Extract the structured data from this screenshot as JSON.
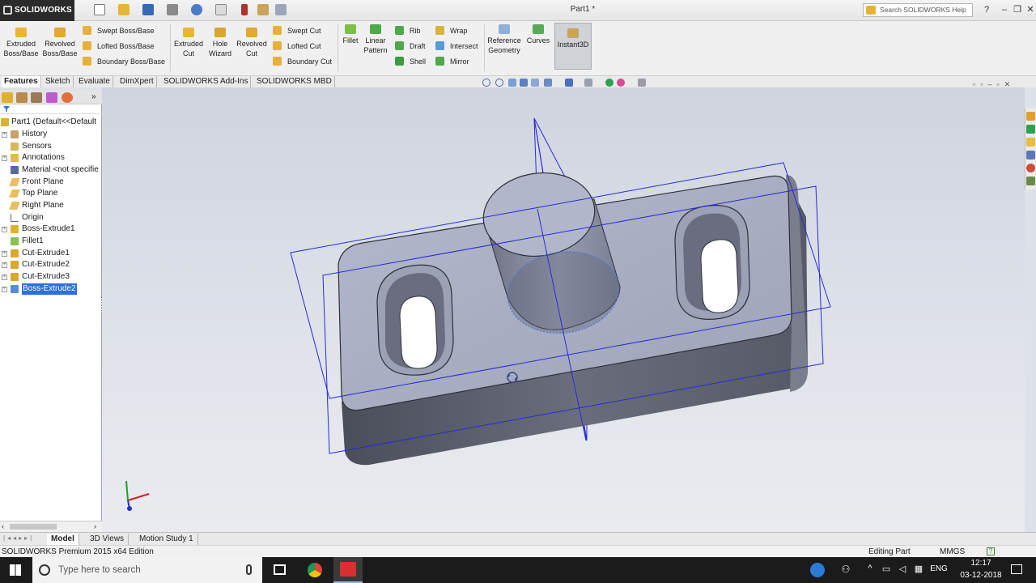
{
  "app": {
    "name": "SOLIDWORKS",
    "doc_title": "Part1 *"
  },
  "search": {
    "placeholder": "Search SOLIDWORKS Help"
  },
  "ribbon": {
    "big_tools": [
      {
        "label": "Extruded\nBoss/Base"
      },
      {
        "label": "Revolved\nBoss/Base"
      },
      {
        "label": "Extruded\nCut"
      },
      {
        "label": "Hole\nWizard"
      },
      {
        "label": "Revolved\nCut"
      },
      {
        "label": "Fillet"
      },
      {
        "label": "Linear\nPattern"
      },
      {
        "label": "Reference\nGeometry"
      },
      {
        "label": "Curves"
      },
      {
        "label": "Instant3D"
      }
    ],
    "small_tools": [
      {
        "label": "Swept Boss/Base"
      },
      {
        "label": "Lofted Boss/Base"
      },
      {
        "label": "Boundary Boss/Base"
      },
      {
        "label": "Swept Cut"
      },
      {
        "label": "Lofted Cut"
      },
      {
        "label": "Boundary Cut"
      },
      {
        "label": "Rib"
      },
      {
        "label": "Draft"
      },
      {
        "label": "Shell"
      },
      {
        "label": "Wrap"
      },
      {
        "label": "Intersect"
      },
      {
        "label": "Mirror"
      }
    ]
  },
  "cm_tabs": [
    "Features",
    "Sketch",
    "Evaluate",
    "DimXpert",
    "SOLIDWORKS Add-Ins",
    "SOLIDWORKS MBD"
  ],
  "tree": {
    "root": "Part1  (Default<<Default",
    "items": [
      {
        "label": "History"
      },
      {
        "label": "Sensors"
      },
      {
        "label": "Annotations"
      },
      {
        "label": "Material <not specifie"
      },
      {
        "label": "Front Plane"
      },
      {
        "label": "Top Plane"
      },
      {
        "label": "Right Plane"
      },
      {
        "label": "Origin"
      },
      {
        "label": "Boss-Extrude1"
      },
      {
        "label": "Fillet1"
      },
      {
        "label": "Cut-Extrude1"
      },
      {
        "label": "Cut-Extrude2"
      },
      {
        "label": "Cut-Extrude3"
      },
      {
        "label": "Boss-Extrude2"
      }
    ]
  },
  "bottom_tabs": [
    "Model",
    "3D Views",
    "Motion Study 1"
  ],
  "status": {
    "left": "SOLIDWORKS Premium 2015 x64 Edition",
    "mode": "Editing Part",
    "units": "MMGS"
  },
  "taskbar": {
    "search_placeholder": "Type here to search",
    "lang": "ENG",
    "time": "12:17",
    "date": "03-12-2018"
  },
  "colors": {
    "accent_blue": "#2d6fd6",
    "model_face": "#a9aec2",
    "plane_edge": "#2a2ad8"
  }
}
